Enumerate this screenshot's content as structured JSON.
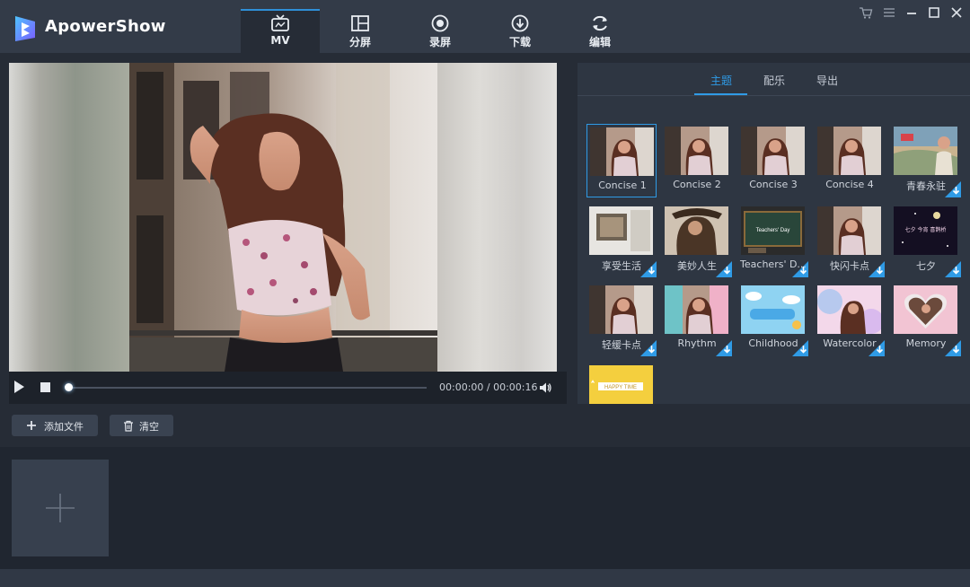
{
  "app": {
    "name": "ApowerShow"
  },
  "nav": {
    "tabs": [
      {
        "label": "MV",
        "icon": "tv-icon",
        "active": true
      },
      {
        "label": "分屏",
        "icon": "split-screen-icon",
        "active": false
      },
      {
        "label": "录屏",
        "icon": "record-icon",
        "active": false
      },
      {
        "label": "下载",
        "icon": "download-icon",
        "active": false
      },
      {
        "label": "编辑",
        "icon": "refresh-edit-icon",
        "active": false
      }
    ]
  },
  "window_controls": [
    "cart-icon",
    "menu-icon",
    "minimize-icon",
    "maximize-icon",
    "close-icon"
  ],
  "player": {
    "time": "00:00:00 / 00:00:16",
    "progress": 0
  },
  "panel": {
    "tabs": [
      {
        "label": "主题",
        "active": true
      },
      {
        "label": "配乐",
        "active": false
      },
      {
        "label": "导出",
        "active": false
      }
    ],
    "themes": [
      {
        "name": "Concise 1",
        "selected": true,
        "download": false
      },
      {
        "name": "Concise 2",
        "selected": false,
        "download": false
      },
      {
        "name": "Concise 3",
        "selected": false,
        "download": false
      },
      {
        "name": "Concise 4",
        "selected": false,
        "download": false
      },
      {
        "name": "青春永驻",
        "selected": false,
        "download": true
      },
      {
        "name": "享受生活",
        "selected": false,
        "download": true
      },
      {
        "name": "美妙人生",
        "selected": false,
        "download": true
      },
      {
        "name": "Teachers' D...",
        "selected": false,
        "download": true
      },
      {
        "name": "快闪卡点",
        "selected": false,
        "download": true
      },
      {
        "name": "七夕",
        "selected": false,
        "download": true
      },
      {
        "name": "轻缓卡点",
        "selected": false,
        "download": true
      },
      {
        "name": "Rhythm",
        "selected": false,
        "download": true
      },
      {
        "name": "Childhood",
        "selected": false,
        "download": true
      },
      {
        "name": "Watercolor",
        "selected": false,
        "download": true
      },
      {
        "name": "Memory",
        "selected": false,
        "download": true
      },
      {
        "name": "",
        "selected": false,
        "download": true
      }
    ],
    "thumb_texts": {
      "teachers": "Teachers' Day",
      "qixi": "七夕 今宵 喜鹊桥",
      "happy": "HAPPY TIME"
    }
  },
  "toolbar": {
    "add_file": "添加文件",
    "clear": "清空"
  },
  "colors": {
    "accent": "#2f9be6",
    "titlebar": "#333b48",
    "background": "#262c36"
  }
}
